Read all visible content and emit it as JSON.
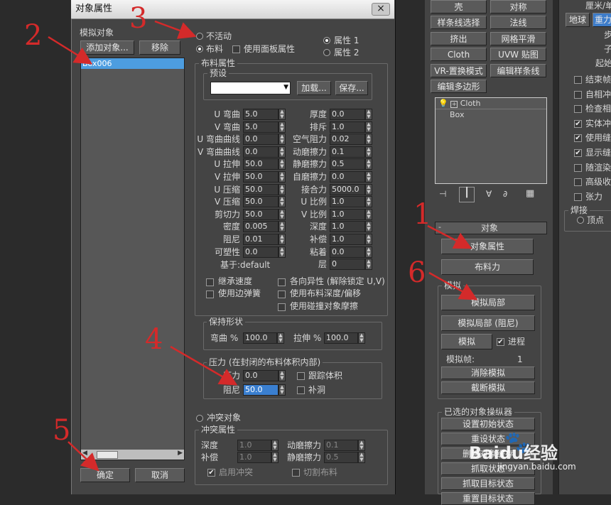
{
  "dialog": {
    "title": "对象属性",
    "close": "×",
    "sim_objects_label": "模拟对象",
    "add_object": "添加对象...",
    "remove": "移除",
    "list_items": [
      "Box006"
    ],
    "ok": "确定",
    "cancel": "取消",
    "inactive": "不活动",
    "cloth": "布料",
    "use_panel_props": "使用面板属性",
    "prop1": "属性 1",
    "prop2": "属性 2",
    "cloth_props_title": "布料属性",
    "preset_title": "预设",
    "load": "加载...",
    "save": "保存...",
    "left_params": [
      {
        "label": "U 弯曲",
        "value": "5.0"
      },
      {
        "label": "V 弯曲",
        "value": "5.0"
      },
      {
        "label": "U 弯曲曲线",
        "value": "0.0"
      },
      {
        "label": "V 弯曲曲线",
        "value": "0.0"
      },
      {
        "label": "U 拉伸",
        "value": "50.0"
      },
      {
        "label": "V 拉伸",
        "value": "50.0"
      },
      {
        "label": "U 压缩",
        "value": "50.0"
      },
      {
        "label": "V 压缩",
        "value": "50.0"
      },
      {
        "label": "剪切力",
        "value": "50.0"
      },
      {
        "label": "密度",
        "value": "0.005"
      },
      {
        "label": "阻尼",
        "value": "0.01"
      },
      {
        "label": "可塑性",
        "value": "0.0"
      }
    ],
    "right_params": [
      {
        "label": "厚度",
        "value": "0.0"
      },
      {
        "label": "排斥",
        "value": "1.0"
      },
      {
        "label": "空气阻力",
        "value": "0.02"
      },
      {
        "label": "动磨擦力",
        "value": "0.1"
      },
      {
        "label": "静磨擦力",
        "value": "0.5"
      },
      {
        "label": "自磨擦力",
        "value": "0.0"
      },
      {
        "label": "接合力",
        "value": "5000.0"
      },
      {
        "label": "U 比例",
        "value": "1.0"
      },
      {
        "label": "V 比例",
        "value": "1.0"
      },
      {
        "label": "深度",
        "value": "1.0"
      },
      {
        "label": "补偿",
        "value": "1.0"
      },
      {
        "label": "粘着",
        "value": "0.0"
      },
      {
        "label": "层",
        "value": "0"
      }
    ],
    "based_on": "基于:default",
    "inherit_velocity": "继承速度",
    "use_edge_springs": "使用边弹簧",
    "anisotropic": "各向异性 (解除锁定 U,V)",
    "use_cloth_depth": "使用布料深度/偏移",
    "use_collision_friction": "使用碰撞对象摩擦",
    "keep_shape_title": "保持形状",
    "bend_pct": "弯曲 %",
    "bend_val": "100.0",
    "stretch_pct": "拉伸 %",
    "stretch_val": "100.0",
    "pressure_title": "压力 (在封闭的布料体积内部)",
    "pressure": "压力",
    "pressure_val": "0.0",
    "damping": "阻尼",
    "damping_val": "50.0",
    "track_volume": "跟踪体积",
    "cap_holes": "补洞",
    "collision_object": "冲突对象",
    "collision_props_title": "冲突属性",
    "c_depth": "深度",
    "c_depth_val": "1.0",
    "c_offset": "补偿",
    "c_offset_val": "1.0",
    "c_dyn_fric": "动磨擦力",
    "c_dyn_val": "0.1",
    "c_stat_fric": "静磨擦力",
    "c_stat_val": "0.5",
    "enable_collision": "启用冲突",
    "cut_cloth": "切割布料"
  },
  "modifier_panel": {
    "grid_buttons": [
      [
        "壳",
        "对称"
      ],
      [
        "样条线选择",
        "法线"
      ],
      [
        "挤出",
        "网格平滑"
      ],
      [
        "Cloth",
        "UVW 贴图"
      ],
      [
        "VR-置换模式",
        "编辑样条线"
      ],
      [
        "编辑多边形",
        ""
      ]
    ],
    "stack": [
      "Cloth",
      "Box"
    ],
    "object_rollout": "对象",
    "object_props": "对象属性",
    "cloth_forces": "布料力",
    "sim_group": "模拟",
    "sim_local": "模拟局部",
    "sim_local_damped": "模拟局部 (阻尼)",
    "simulate": "模拟",
    "progress": "进程",
    "sim_frame_label": "模拟帧:",
    "sim_frame_val": "1",
    "erase_sim": "消除模拟",
    "truncate_sim": "截断模拟",
    "selected_obj_manip": "已选的对象操纵器",
    "set_initial_state": "设置初始状态",
    "reset_state": "重设状态",
    "delete_obj_cache": "删除对象缓存",
    "grab_state": "抓取状态",
    "grab_target_state": "抓取目标状态",
    "reset_target_state": "重置目标状态"
  },
  "far_right": {
    "top_label": "厘米/单",
    "earth": "地球",
    "heavy": "重力",
    "step": "步",
    "sub": "子",
    "start": "起始",
    "checks": [
      {
        "label": "结束帧",
        "checked": false
      },
      {
        "label": "自相冲",
        "checked": false
      },
      {
        "label": "检查相",
        "checked": false
      },
      {
        "label": "实体冲",
        "checked": true
      },
      {
        "label": "使用缝",
        "checked": true
      },
      {
        "label": "显示缝",
        "checked": true
      },
      {
        "label": "随渲染",
        "checked": false
      },
      {
        "label": "高级收",
        "checked": false
      },
      {
        "label": "张力",
        "checked": false
      }
    ],
    "weld": "焊接",
    "vertex": "顶点"
  },
  "annotations": [
    "1",
    "2",
    "3",
    "4",
    "5",
    "6"
  ],
  "watermark": "Baidu经验",
  "watermark_url": "jingyan.baidu.com"
}
